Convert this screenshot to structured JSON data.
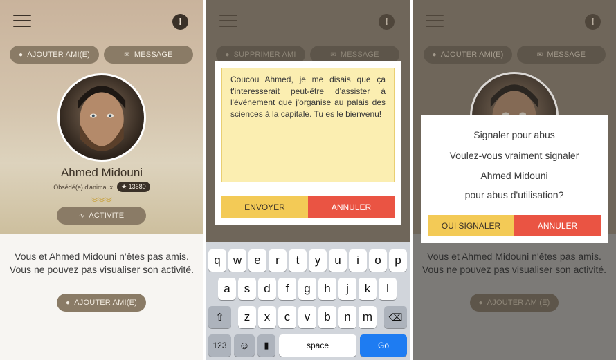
{
  "screen1": {
    "header": {
      "menu_icon": "hamburger-icon",
      "alert_icon": "exclamation-icon",
      "alert_glyph": "!"
    },
    "actions": {
      "add_friend": "AJOUTER AMI(E)",
      "message": "MESSAGE"
    },
    "profile": {
      "name": "Ahmed Midouni",
      "subtitle": "Obsédé(e) d'animaux",
      "score": "13680"
    },
    "activity_button": "ACTIVITE",
    "notice": "Vous et Ahmed Midouni n'êtes pas amis. Vous ne pouvez pas visualiser son activité.",
    "add_friend_bottom": "AJOUTER AMI(E)"
  },
  "screen2": {
    "actions": {
      "remove_friend": "SUPPRIMER AMI",
      "message": "MESSAGE"
    },
    "message_text": "Coucou Ahmed, je me disais que ça t'interesserait peut-être d'assister à l'événement que j'organise au palais des sciences à la capitale. Tu es le bienvenu!",
    "send_button": "ENVOYER",
    "cancel_button": "ANNULER",
    "keyboard": {
      "row1": [
        "q",
        "w",
        "e",
        "r",
        "t",
        "y",
        "u",
        "i",
        "o",
        "p"
      ],
      "row2": [
        "a",
        "s",
        "d",
        "f",
        "g",
        "h",
        "j",
        "k",
        "l"
      ],
      "row3": [
        "z",
        "x",
        "c",
        "v",
        "b",
        "n",
        "m"
      ],
      "numbers": "123",
      "space": "space",
      "go": "Go"
    }
  },
  "screen3": {
    "actions": {
      "add_friend": "AJOUTER AMI(E)",
      "message": "MESSAGE"
    },
    "report_dialog": {
      "title": "Signaler pour abus",
      "question": "Voulez-vous vraiment signaler",
      "name": "Ahmed Midouni",
      "reason": "pour abus d'utilisation?",
      "confirm_button": "OUI SIGNALER",
      "cancel_button": "ANNULER"
    },
    "notice": "Vous et Ahmed Midouni n'êtes pas amis. Vous ne pouvez pas visualiser son activité.",
    "add_friend_bottom": "AJOUTER AMI(E)"
  },
  "colors": {
    "yellow": "#f3ca56",
    "red": "#ea5443",
    "pill": "#8a7b66",
    "keyboard_go": "#1e7cf2"
  }
}
